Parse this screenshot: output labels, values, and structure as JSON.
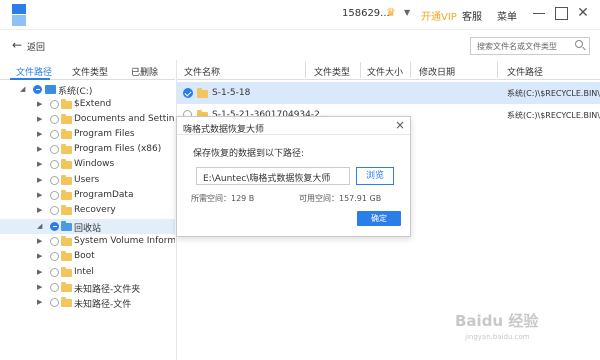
{
  "titlebar": {
    "user": "158629...",
    "crown_icon": "crown-icon",
    "vip": "开通VIP",
    "service": "客服",
    "menu": "菜单",
    "colors": {
      "accent": "#2b7de9",
      "vip": "#f5a623"
    }
  },
  "toolbar": {
    "back_label": "返回",
    "search_placeholder": "搜索文件名或文件类型"
  },
  "tabs": [
    "文件路径",
    "文件类型",
    "已删除"
  ],
  "tree": [
    {
      "label": "系统(C:)",
      "type": "drive",
      "state": "partial"
    },
    {
      "label": "$Extend",
      "type": "folder"
    },
    {
      "label": "Documents and Settings",
      "type": "folder"
    },
    {
      "label": "Program Files",
      "type": "folder"
    },
    {
      "label": "Program Files (x86)",
      "type": "folder"
    },
    {
      "label": "Windows",
      "type": "folder"
    },
    {
      "label": "Users",
      "type": "folder"
    },
    {
      "label": "ProgramData",
      "type": "folder"
    },
    {
      "label": "Recovery",
      "type": "folder"
    },
    {
      "label": "回收站",
      "type": "recycle",
      "state": "partial",
      "selected": true
    },
    {
      "label": "System Volume Informa",
      "type": "folder"
    },
    {
      "label": "Boot",
      "type": "folder"
    },
    {
      "label": "Intel",
      "type": "folder"
    },
    {
      "label": "未知路径-文件夹",
      "type": "folder"
    },
    {
      "label": "未知路径-文件",
      "type": "folder"
    }
  ],
  "columns": [
    "文件名称",
    "文件类型",
    "文件大小",
    "修改日期",
    "文件路径"
  ],
  "rows": [
    {
      "name": "S-1-5-18",
      "path": "系统(C:)\\$RECYCLE.BIN\\",
      "selected": true
    },
    {
      "name": "S-1-5-21-3601704934-2...",
      "path": "系统(C:)\\$RECYCLE.BIN\\",
      "selected": false
    }
  ],
  "dialog": {
    "title": "嗨格式数据恢复大师",
    "prompt": "保存恢复的数据到以下路径:",
    "path_value": "E:\\Auntec\\嗨格式数据恢复大师",
    "browse": "浏览",
    "required_space": "所需空间：129 B",
    "free_space": "可用空间：157.91 GB",
    "ok": "确定"
  },
  "watermark": {
    "text": "Baidu 经验",
    "url": "jingyan.baidu.com"
  }
}
